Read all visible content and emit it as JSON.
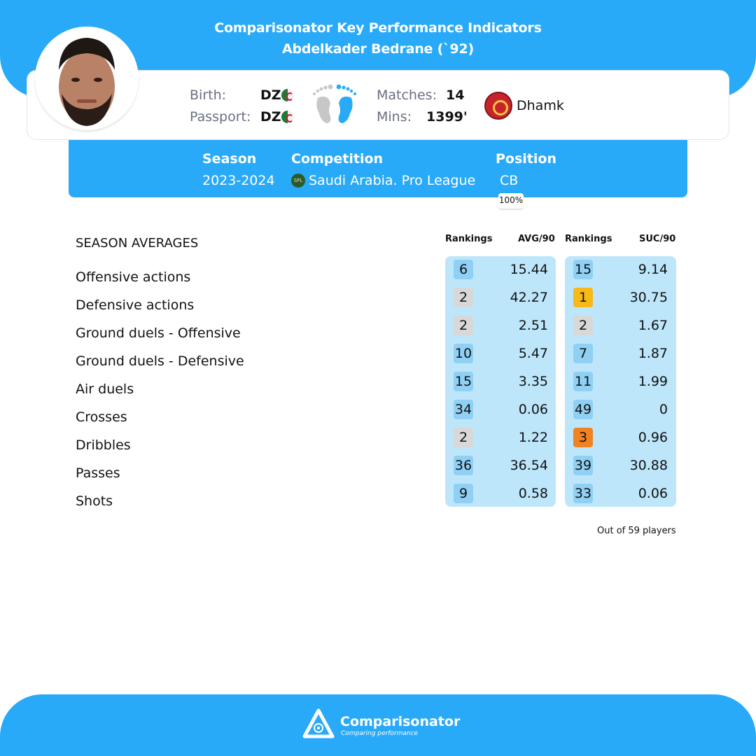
{
  "header": {
    "title": "Comparisonator Key Performance Indicators",
    "player": "Abdelkader Bedrane (`92)"
  },
  "profile": {
    "birth_label": "Birth:",
    "birth_value": "DZ",
    "passport_label": "Passport:",
    "passport_value": "DZ",
    "matches_label": "Matches:",
    "matches_value": "14",
    "mins_label": "Mins:",
    "mins_value": "1399'",
    "club": "Dhamk",
    "preferred_foot": "right"
  },
  "season_info": {
    "season_label": "Season",
    "season_value": "2023-2024",
    "competition_label": "Competition",
    "competition_value": "Saudi Arabia. Pro League",
    "position_label": "Position",
    "position_value": "CB",
    "position_pct": "100%"
  },
  "table": {
    "section_title": "SEASON AVERAGES",
    "headers": {
      "rank1": "Rankings",
      "avg": "AVG/90",
      "rank2": "Rankings",
      "suc": "SUC/90"
    },
    "rows": [
      {
        "metric": "Offensive actions",
        "avg_rank": "6",
        "avg_rank_tier": "blue",
        "avg": "15.44",
        "suc_rank": "15",
        "suc_rank_tier": "blue",
        "suc": "9.14"
      },
      {
        "metric": "Defensive actions",
        "avg_rank": "2",
        "avg_rank_tier": "grey",
        "avg": "42.27",
        "suc_rank": "1",
        "suc_rank_tier": "gold",
        "suc": "30.75"
      },
      {
        "metric": "Ground duels - Offensive",
        "avg_rank": "2",
        "avg_rank_tier": "grey",
        "avg": "2.51",
        "suc_rank": "2",
        "suc_rank_tier": "grey",
        "suc": "1.67"
      },
      {
        "metric": "Ground duels - Defensive",
        "avg_rank": "10",
        "avg_rank_tier": "blue",
        "avg": "5.47",
        "suc_rank": "7",
        "suc_rank_tier": "blue",
        "suc": "1.87"
      },
      {
        "metric": "Air duels",
        "avg_rank": "15",
        "avg_rank_tier": "blue",
        "avg": "3.35",
        "suc_rank": "11",
        "suc_rank_tier": "blue",
        "suc": "1.99"
      },
      {
        "metric": "Crosses",
        "avg_rank": "34",
        "avg_rank_tier": "blue",
        "avg": "0.06",
        "suc_rank": "49",
        "suc_rank_tier": "blue",
        "suc": "0"
      },
      {
        "metric": "Dribbles",
        "avg_rank": "2",
        "avg_rank_tier": "grey",
        "avg": "1.22",
        "suc_rank": "3",
        "suc_rank_tier": "orange",
        "suc": "0.96"
      },
      {
        "metric": "Passes",
        "avg_rank": "36",
        "avg_rank_tier": "blue",
        "avg": "36.54",
        "suc_rank": "39",
        "suc_rank_tier": "blue",
        "suc": "30.88"
      },
      {
        "metric": "Shots",
        "avg_rank": "9",
        "avg_rank_tier": "blue",
        "avg": "0.58",
        "suc_rank": "33",
        "suc_rank_tier": "blue",
        "suc": "0.06"
      }
    ],
    "footnote": "Out of 59 players"
  },
  "footer": {
    "brand": "Comparisonator",
    "tagline": "Comparing performance"
  },
  "colors": {
    "brand_blue": "#29aaf8",
    "panel_blue": "#bde6fb",
    "rank_blue": "#8fd0f4",
    "rank_silver": "#d8d8d8",
    "rank_gold": "#f6b915",
    "rank_bronze": "#f08221"
  }
}
